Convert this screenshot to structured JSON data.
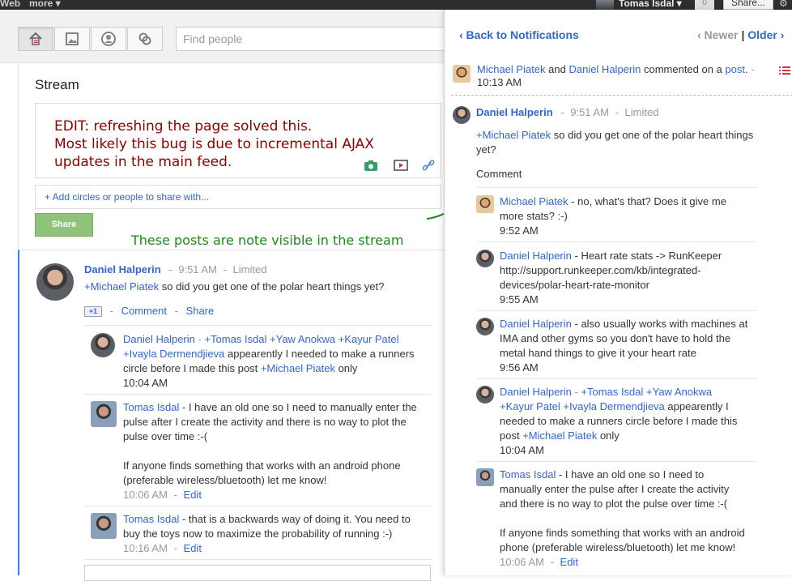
{
  "topbar": {
    "nav_web": "Web",
    "nav_more": "more ▾",
    "user_name": "Tomas Isdal ▾",
    "notif_count": "0",
    "share_label": "Share...",
    "gear": "⚙"
  },
  "header": {
    "find_placeholder": "Find people",
    "nav_buttons": [
      "home-icon",
      "photos-icon",
      "profile-icon",
      "circles-icon"
    ]
  },
  "stream": {
    "title": "Stream",
    "edit_note_lines": [
      "EDIT: refreshing the page solved this.",
      "Most likely this bug is due to incremental AJAX",
      "updates in the main feed."
    ],
    "add_circles": "+ Add circles or people to share with...",
    "share_button": "Share",
    "annotation": "These posts are note visible in the stream"
  },
  "left_post": {
    "author": "Daniel Halperin",
    "sep": "-",
    "time": "9:51 AM",
    "visibility": "Limited",
    "mention": "+Michael Piatek",
    "text": " so did you get one of the polar heart things yet?",
    "plusone": "+1",
    "comment_label": "Comment",
    "share_label": "Share",
    "comments": [
      {
        "author": "Daniel Halperin",
        "lines": [
          [
            " - ",
            "+Tomas Isdal",
            " ",
            "+Yaw Anokwa",
            " ",
            "+Kayur Patel"
          ],
          [
            "+Ivayla Dermendjieva",
            " appearently I needed to make a runners"
          ],
          [
            "circle before I made this post ",
            "+Michael Piatek",
            " only"
          ]
        ],
        "time": "10:04 AM"
      },
      {
        "author": "Tomas Isdal",
        "lines": [
          " - I have an old one so I need to manually enter the",
          "pulse after I create the activity and there is no way to plot the",
          "pulse over time :-(",
          "",
          "If anyone finds something that works with an android phone",
          "(preferable wireless/bluetooth) let me know!"
        ],
        "time": "10:06 AM",
        "edit": "Edit"
      },
      {
        "author": "Tomas Isdal",
        "lines": [
          " - that is a backwards way of doing it. You need to",
          "buy the toys now to maximize the probability of running :-)"
        ],
        "time": "10:16 AM",
        "edit": "Edit"
      }
    ]
  },
  "panel": {
    "back": "‹ Back to Notifications",
    "newer": "‹ Newer",
    "divider": "|",
    "older": "Older ›",
    "summary": {
      "author1": "Michael Piatek",
      "and": " and ",
      "author2": "Daniel Halperin",
      "text": " commented on a ",
      "post": "post",
      "end": ".",
      "dash": " -",
      "time": "10:13 AM"
    },
    "post": {
      "author": "Daniel Halperin",
      "time": "9:51 AM",
      "visibility": "Limited",
      "mention": "+Michael Piatek",
      "text_line1": " so did you get one of the polar heart things",
      "text_line2": "yet?",
      "comment_label": "Comment"
    },
    "comments": [
      {
        "author": "Michael Piatek",
        "lines": [
          " - no, what's that? Does it give me",
          "more stats? :-)"
        ],
        "time": "9:52 AM"
      },
      {
        "author": "Daniel Halperin",
        "lines": [
          " - Heart rate stats -> RunKeeper"
        ],
        "link1": "http://support.runkeeper.com/kb/integrated-",
        "link2": "devices/polar-heart-rate-monitor",
        "time": "9:55 AM"
      },
      {
        "author": "Daniel Halperin",
        "lines": [
          " - also usually works with machines at",
          "IMA and other gyms so you don't have to hold the",
          "metal hand things to give it your heart rate"
        ],
        "time": "9:56 AM"
      },
      {
        "author": "Daniel Halperin",
        "l1": " - ",
        "m1": "+Tomas Isdal",
        "m2": "+Yaw Anokwa",
        "m3": "+Kayur Patel",
        "m4": "+Ivayla Dermendjieva",
        "l2": " appearently I",
        "l3": "needed to make a runners circle before I made this",
        "l4a": "post ",
        "m5": "+Michael Piatek",
        "l4b": " only",
        "time": "10:04 AM"
      },
      {
        "author": "Tomas Isdal",
        "lines": [
          " - I have an old one so I need to",
          "manually enter the pulse after I create the activity",
          "and there is no way to plot the pulse over time :-(",
          "",
          "If anyone finds something that works with an android",
          "phone (preferable wireless/bluetooth) let me know!"
        ],
        "time": "10:06 AM",
        "edit": "Edit"
      }
    ]
  }
}
